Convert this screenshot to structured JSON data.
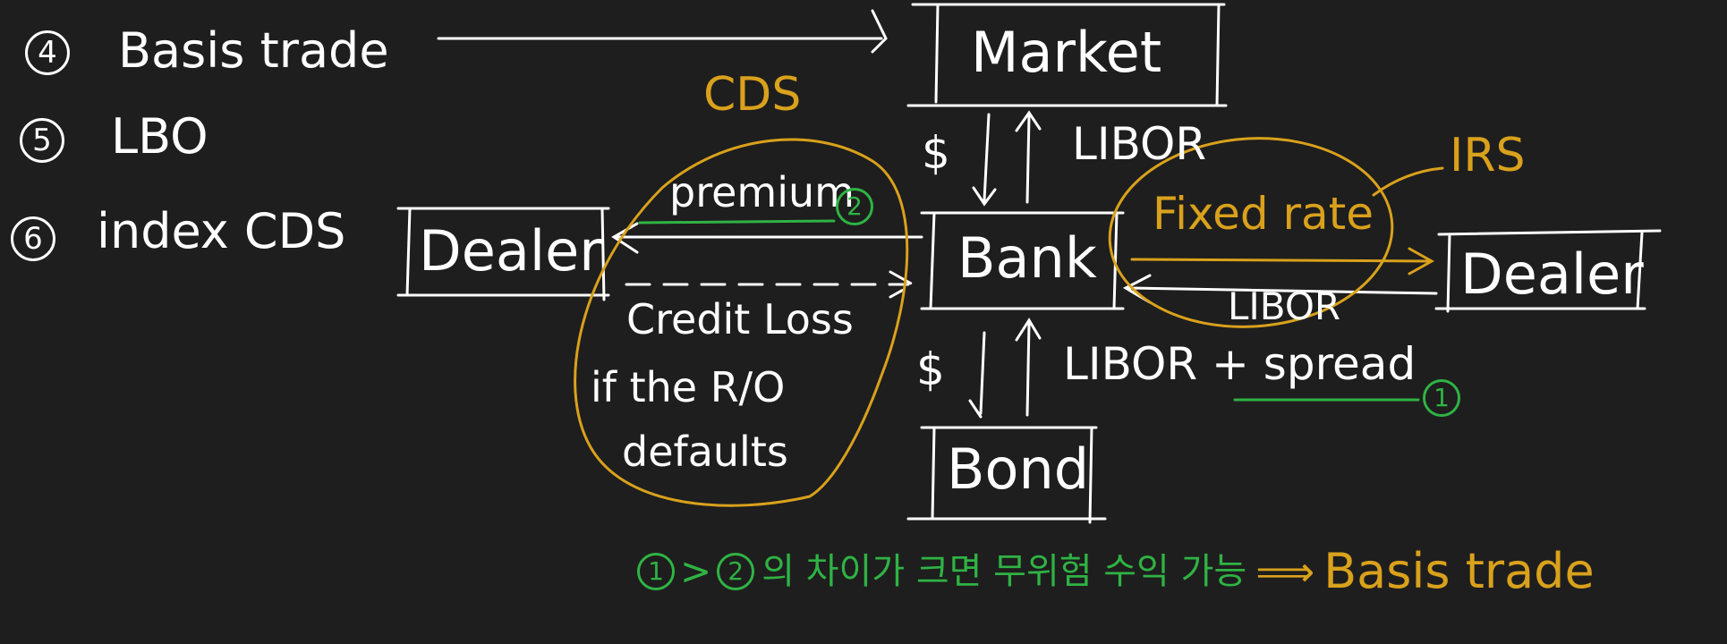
{
  "list": {
    "item4": {
      "num": "4",
      "text": "Basis trade"
    },
    "item5": {
      "num": "5",
      "text": "LBO"
    },
    "item6": {
      "num": "6",
      "text": "index CDS"
    }
  },
  "boxes": {
    "market": "Market",
    "bank": "Bank",
    "bond": "Bond",
    "dealer_left": "Dealer",
    "dealer_right": "Dealer"
  },
  "labels": {
    "cds": "CDS",
    "premium": "premium",
    "marker2": "2",
    "credit_loss_line1": "Credit Loss",
    "credit_loss_line2": "if the R/O",
    "credit_loss_line3": "defaults",
    "dollar_top": "$",
    "libor_top": "LIBOR",
    "irs": "IRS",
    "fixed_rate": "Fixed rate",
    "libor_irs": "LIBOR",
    "dollar_bottom": "$",
    "libor_spread": "LIBOR + spread",
    "marker1": "1"
  },
  "footer": {
    "n1": "1",
    "gt": ">",
    "n2": "2",
    "korean": "의 차이가 크면 무위험 수익 가능",
    "arrow": "⟹",
    "result": "Basis trade"
  },
  "colors": {
    "background": "#1e1e1e",
    "chalk_white": "#ffffff",
    "highlight_orange": "#d9a11c",
    "highlight_green": "#2fb344"
  }
}
